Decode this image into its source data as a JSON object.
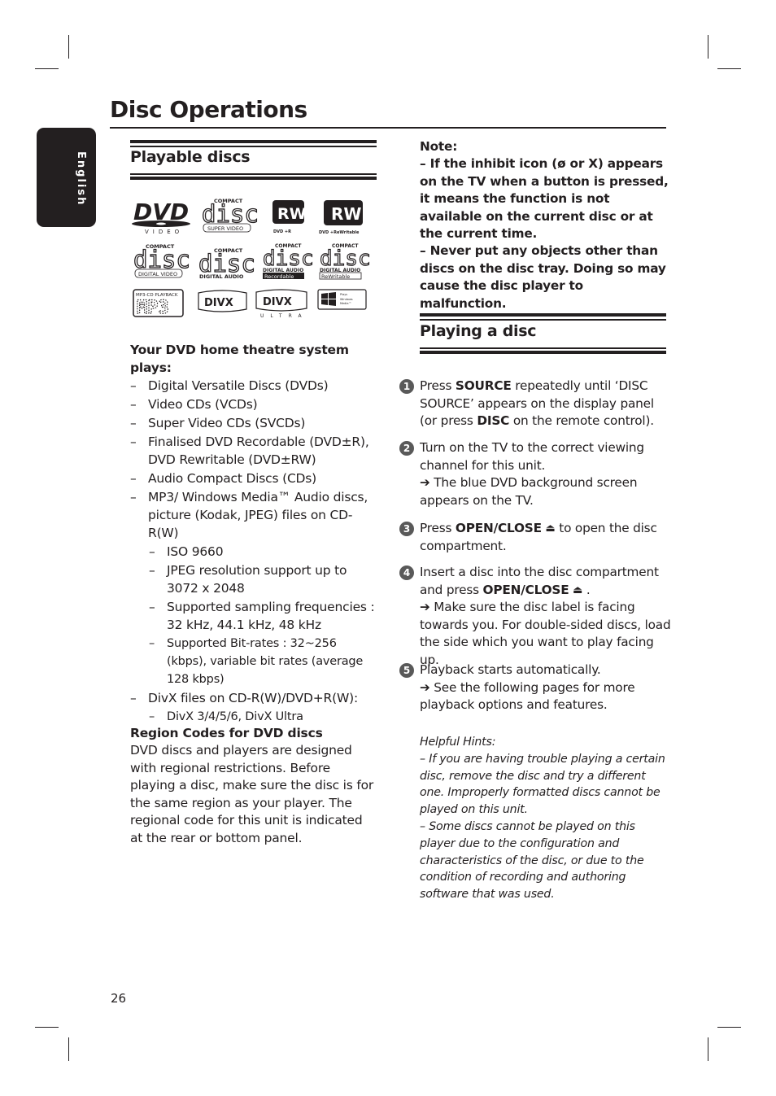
{
  "header": {
    "page_title": "Disc Operations",
    "language_tab": "English"
  },
  "playable": {
    "section_title": "Playable discs",
    "logos": [
      {
        "name": "dvd-video-logo",
        "line1": "DVD",
        "line2": "VIDEO"
      },
      {
        "name": "compact-disc-super-video-logo",
        "line1": "COMPACT",
        "line2": "disc",
        "line3": "SUPER VIDEO"
      },
      {
        "name": "dvd-plus-r-logo",
        "line1": "RW",
        "line2": "DVD +R"
      },
      {
        "name": "dvd-plus-rewritable-logo",
        "line1": "RW",
        "line2": "DVD +ReWritable"
      },
      {
        "name": "compact-disc-digital-video-logo",
        "line1": "COMPACT",
        "line2": "disc",
        "line3": "DIGITAL VIDEO"
      },
      {
        "name": "compact-disc-digital-audio-logo",
        "line1": "COMPACT",
        "line2": "disc",
        "line3": "DIGITAL AUDIO"
      },
      {
        "name": "compact-disc-recordable-logo",
        "line1": "COMPACT",
        "line2": "disc",
        "line3": "DIGITAL AUDIO",
        "line4": "Recordable"
      },
      {
        "name": "compact-disc-rewritable-logo",
        "line1": "COMPACT",
        "line2": "disc",
        "line3": "DIGITAL AUDIO",
        "line4": "ReWritable"
      },
      {
        "name": "mp3-cd-playback-logo",
        "line1": "MP3-CD PLAYBACK",
        "line2": "MP3"
      },
      {
        "name": "divx-logo",
        "line1": "DIVX"
      },
      {
        "name": "divx-ultra-logo",
        "line1": "DIVX",
        "line2": "ULTRA"
      },
      {
        "name": "windows-media-logo",
        "line1": "Plays",
        "line2": "Windows",
        "line3": "Media™"
      }
    ],
    "plays_heading": "Your DVD home theatre system plays:",
    "items": [
      "Digital Versatile Discs (DVDs)",
      "Video CDs (VCDs)",
      "Super Video CDs (SVCDs)",
      "Finalised DVD Recordable (DVD±R), DVD Rewritable (DVD±RW)",
      "Audio Compact Discs (CDs)",
      "MP3/ Windows Media™ Audio discs, picture (Kodak, JPEG) files on CD-R(W)"
    ],
    "sub_items": [
      "ISO 9660",
      "JPEG resolution support up to 3072 x 2048",
      "Supported sampling frequencies : 32 kHz, 44.1 kHz, 48 kHz",
      "Supported Bit-rates : 32~256 (kbps), variable bit rates (average 128 kbps)"
    ],
    "divx_item": "DivX files on CD-R(W)/DVD+R(W):",
    "divx_sub": "DivX 3/4/5/6, DivX Ultra",
    "dash": "–",
    "region_heading": "Region Codes for DVD discs",
    "region_text": "DVD discs and players are designed with regional restrictions. Before playing a disc, make sure the disc is for the same region as your player.  The regional code for this unit is indicated at the rear or bottom panel."
  },
  "note": {
    "heading": "Note:",
    "line1": "– If the inhibit icon (ø or X) appears on the TV when a button is pressed, it means the function is not available on the current disc or at the current time.",
    "line2": "– Never put any objects other than discs on the disc tray.  Doing so may cause the disc player to malfunction."
  },
  "playing": {
    "section_title": "Playing a disc",
    "steps": [
      {
        "num": "1",
        "pre": "Press ",
        "b1": "SOURCE",
        "mid": " repeatedly until ‘DISC SOURCE’ appears on the display panel (or press ",
        "b2": "DISC",
        "post": " on the remote control)."
      },
      {
        "num": "2",
        "text": "Turn on the TV to the correct viewing channel for this unit.",
        "result": "➔ The blue DVD background screen appears on the TV."
      },
      {
        "num": "3",
        "pre": "Press ",
        "b1": "OPEN/CLOSE",
        "eject": "⏏",
        "post": " to open the disc compartment."
      },
      {
        "num": "4",
        "pre": "Insert a disc into the disc compartment and press ",
        "b1": "OPEN/CLOSE",
        "eject": "⏏",
        "post": " .",
        "result": "➔ Make sure the disc label is facing towards you. For double-sided discs, load the side which you want to play facing up."
      },
      {
        "num": "5",
        "text": "Playback starts automatically.",
        "result": "➔ See the following pages for more playback options and features."
      }
    ]
  },
  "hints": {
    "heading": "Helpful Hints:",
    "line1": "– If you are having trouble playing a certain disc, remove the disc and try a different one. Improperly formatted discs cannot be played on this unit.",
    "line2": "– Some discs cannot be played on this player due to the configuration and characteristics of the disc, or due to the condition of recording and authoring software that was used."
  },
  "footer": {
    "page_number": "26"
  }
}
